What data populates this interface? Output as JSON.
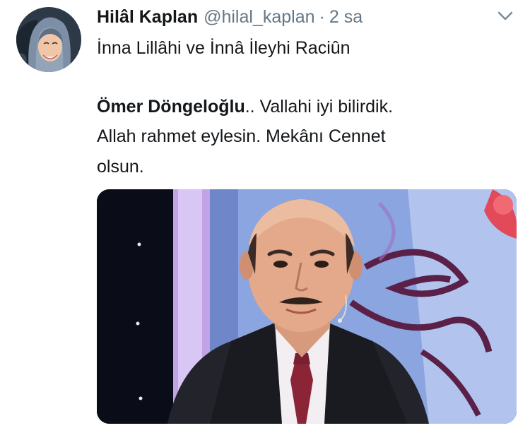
{
  "tweet": {
    "author_name": "Hilâl Kaplan",
    "handle": "@hilal_kaplan",
    "separator": "·",
    "time": "2 sa",
    "text_line1": "İnna Lillâhi ve İnnâ İleyhi Raciûn",
    "mention_bold": "Ömer Döngeloğlu",
    "text_line2_rest": ".. Vallahi iyi bilirdik.",
    "text_line3": "Allah rahmet eylesin. Mekânı Cennet",
    "text_line4": "olsun."
  },
  "icons": {
    "menu": "chevron-down-icon"
  }
}
